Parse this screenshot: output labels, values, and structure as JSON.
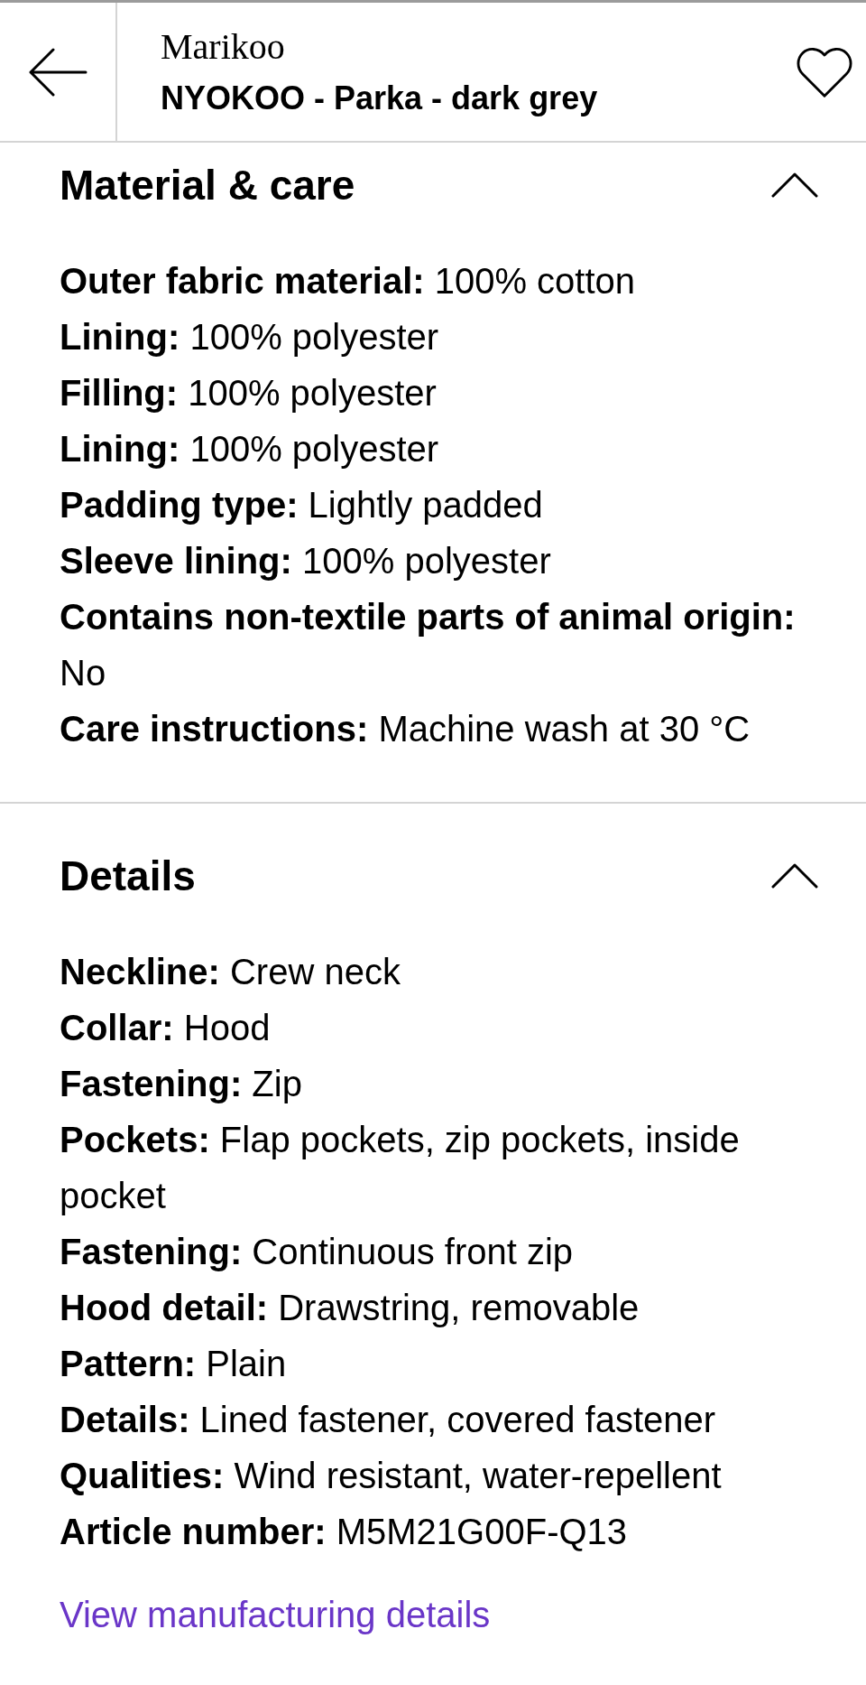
{
  "header": {
    "brand": "Marikoo",
    "title": "NYOKOO - Parka - dark grey",
    "favorited": false
  },
  "sections": [
    {
      "title": "Material & care",
      "expanded": true,
      "attributes": [
        "**Outer fabric material:** 100% cotton",
        "**Lining:** 100% polyester",
        "**Filling:** 100% polyester",
        "**Lining:** 100% polyester",
        "**Padding type:** Lightly padded",
        "**Sleeve lining:** 100% polyester",
        "**Contains non-textile parts of animal origin:** No",
        "**Care instructions:** Machine wash at 30 °C"
      ]
    },
    {
      "title": "Details",
      "expanded": true,
      "attributes": [
        "**Neckline:** Crew neck",
        "**Collar:** Hood",
        "**Fastening:** Zip",
        "**Pockets:** Flap pockets, zip pockets, inside pocket",
        "**Fastening:** Continuous front zip",
        "**Hood detail:** Drawstring, removable",
        "**Pattern:** Plain",
        "**Details:** Lined fastener, covered fastener",
        "**Qualities:** Wind resistant, water-repellent",
        "**Article number:** M5M21G00F-Q13"
      ],
      "link": "View manufacturing details"
    }
  ]
}
